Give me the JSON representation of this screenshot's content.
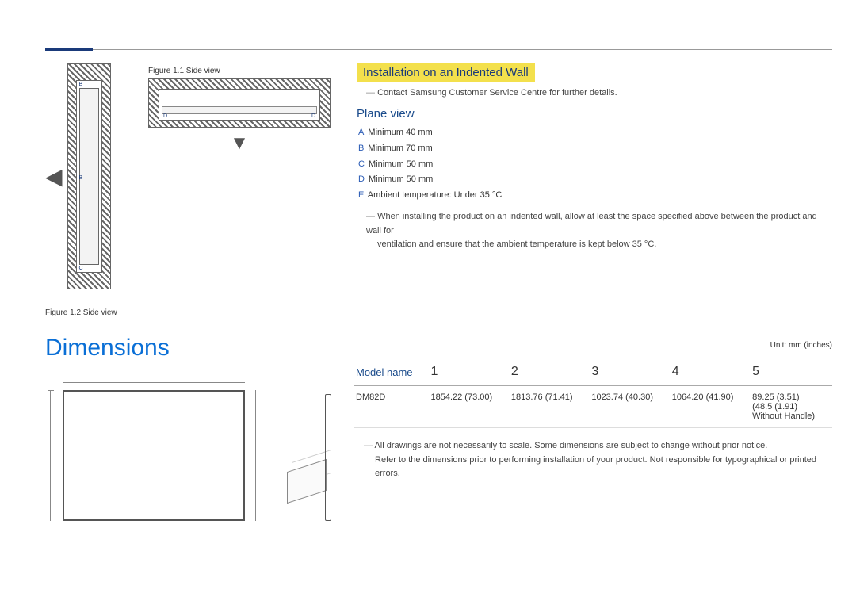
{
  "header": {},
  "figures": {
    "fig1_label": "Figure 1.1 Side view",
    "fig2_label": "Figure 1.2 Side view"
  },
  "installation": {
    "heading": "Installation on an Indented Wall",
    "contact_note": "Contact Samsung Customer Service Centre for further details.",
    "plane_heading": "Plane view",
    "specs": [
      {
        "label": "A",
        "text": "Minimum 40 mm"
      },
      {
        "label": "B",
        "text": "Minimum 70 mm"
      },
      {
        "label": "C",
        "text": "Minimum 50 mm"
      },
      {
        "label": "D",
        "text": "Minimum 50 mm"
      },
      {
        "label": "E",
        "text": "Ambient temperature: Under 35 °C"
      }
    ],
    "install_note_lead": "When installing the product on an indented wall, allow at least the space specified above between the product and wall for",
    "install_note_cont": "ventilation and ensure that the ambient temperature is kept below 35 °C."
  },
  "dimensions": {
    "title": "Dimensions",
    "unit_label": "Unit: mm (inches)",
    "headers": {
      "model_name": "Model name",
      "c1": "1",
      "c2": "2",
      "c3": "3",
      "c4": "4",
      "c5": "5"
    },
    "rows": [
      {
        "model": "DM82D",
        "c1": "1854.22 (73.00)",
        "c2": "1813.76 (71.41)",
        "c3": "1023.74 (40.30)",
        "c4": "1064.20 (41.90)",
        "c5a": "89.25 (3.51)",
        "c5b": "(48.5 (1.91)",
        "c5c": "Without Handle)"
      }
    ],
    "note_lead": "All drawings are not necessarily to scale. Some dimensions are subject to change without prior notice.",
    "note_cont": "Refer to the dimensions prior to performing installation of your product. Not responsible for typographical or printed errors."
  }
}
